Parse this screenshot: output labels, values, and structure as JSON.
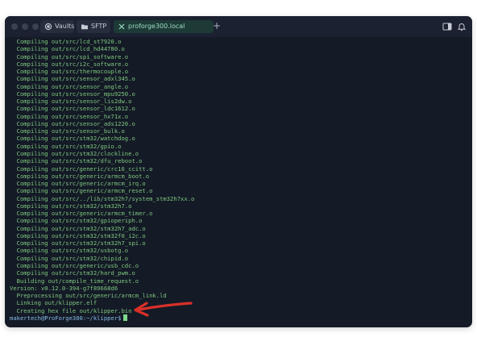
{
  "tabs": [
    {
      "label": "Vaults",
      "icon": "vaults-icon"
    },
    {
      "label": "SFTP",
      "icon": "folder-icon"
    },
    {
      "label": "proforge300.local",
      "icon": "close-icon"
    }
  ],
  "colors": {
    "background": "#141a26",
    "output_text": "#7fc77f",
    "prompt_text": "#86b9e8",
    "annotation_arrow": "#d9302a"
  },
  "terminal": {
    "lines": [
      "  Compiling out/src/lcd_st7920.o",
      "  Compiling out/src/lcd_hd44780.o",
      "  Compiling out/src/spi_software.o",
      "  Compiling out/src/i2c_software.o",
      "  Compiling out/src/thermocouple.o",
      "  Compiling out/src/sensor_adxl345.o",
      "  Compiling out/src/sensor_angle.o",
      "  Compiling out/src/sensor_mpu9250.o",
      "  Compiling out/src/sensor_lis2dw.o",
      "  Compiling out/src/sensor_ldc1612.o",
      "  Compiling out/src/sensor_hx71x.o",
      "  Compiling out/src/sensor_ads1220.o",
      "  Compiling out/src/sensor_bulk.o",
      "  Compiling out/src/stm32/watchdog.o",
      "  Compiling out/src/stm32/gpio.o",
      "  Compiling out/src/stm32/clockline.o",
      "  Compiling out/src/stm32/dfu_reboot.o",
      "  Compiling out/src/generic/crc16_ccitt.o",
      "  Compiling out/src/generic/armcm_boot.o",
      "  Compiling out/src/generic/armcm_irq.o",
      "  Compiling out/src/generic/armcm_reset.o",
      "  Compiling out/src/../lib/stm32h7/system_stm32h7xx.o",
      "  Compiling out/src/stm32/stm32h7.o",
      "  Compiling out/src/generic/armcm_timer.o",
      "  Compiling out/src/stm32/gpioperiph.o",
      "  Compiling out/src/stm32/stm32h7_adc.o",
      "  Compiling out/src/stm32/stm32f0_i2c.o",
      "  Compiling out/src/stm32/stm32h7_spi.o",
      "  Compiling out/src/stm32/usbotg.o",
      "  Compiling out/src/stm32/chipid.o",
      "  Compiling out/src/generic/usb_cdc.o",
      "  Compiling out/src/stm32/hard_pwm.o",
      "  Building out/compile_time_request.o",
      "Version: v0.12.0-394-g7f89668d6",
      "  Preprocessing out/src/generic/armcm_link.ld",
      "  Linking out/klipper.elf",
      "  Creating hex file out/klipper.bin"
    ],
    "prompt": "makertech@ProForge300:~/klipper$"
  }
}
